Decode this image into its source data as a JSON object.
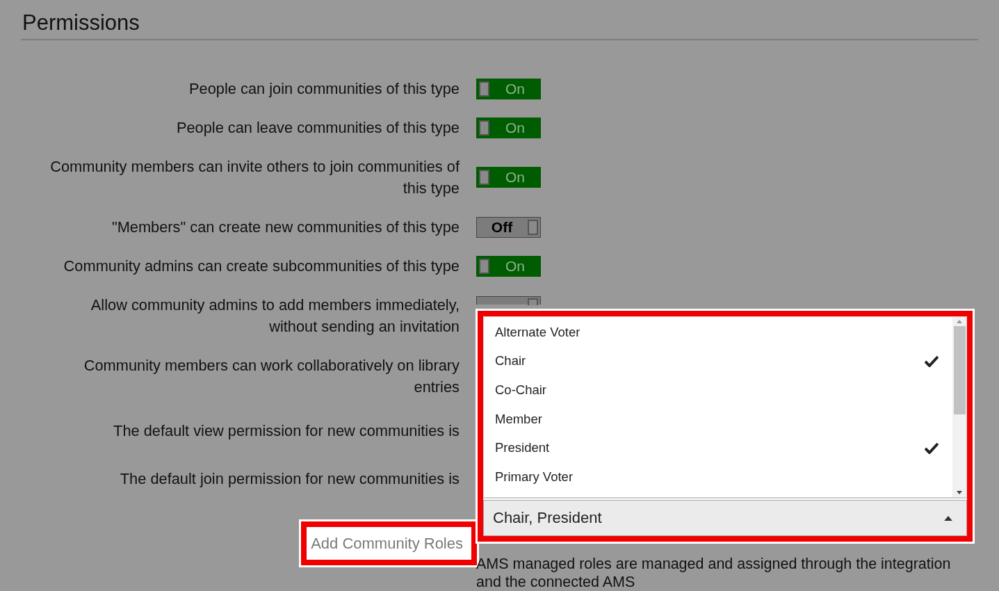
{
  "heading": "Permissions",
  "settings": [
    {
      "label": "People can join communities of this type",
      "kind": "toggle",
      "on": true,
      "toggle_text": "On"
    },
    {
      "label": "People can leave communities of this type",
      "kind": "toggle",
      "on": true,
      "toggle_text": "On"
    },
    {
      "label": "Community members can invite others to join communities of this type",
      "kind": "toggle",
      "on": true,
      "toggle_text": "On"
    },
    {
      "label": "\"Members\" can create new communities of this type",
      "kind": "toggle",
      "on": false,
      "toggle_text": "Off"
    },
    {
      "label": "Community admins can create subcommunities of this type",
      "kind": "toggle",
      "on": true,
      "toggle_text": "On"
    },
    {
      "label": "Allow community admins to add members immediately, without sending an invitation",
      "kind": "toggle-covered",
      "on": false
    },
    {
      "label": "Community members can work collaboratively on library entries",
      "kind": "covered"
    },
    {
      "label": "The default view permission for new communities is",
      "kind": "covered"
    },
    {
      "label": "The default join permission for new communities is",
      "kind": "covered"
    }
  ],
  "roles": {
    "label": "Add Community Roles",
    "highlighted": true,
    "note": "AMS managed roles are managed and assigned through the integration and the connected AMS"
  },
  "dropdown": {
    "highlighted": true,
    "expanded": true,
    "value": "Chair, President",
    "options": [
      {
        "label": "Alternate Voter",
        "checked": false
      },
      {
        "label": "Chair",
        "checked": true
      },
      {
        "label": "Co-Chair",
        "checked": false
      },
      {
        "label": "Member",
        "checked": false
      },
      {
        "label": "President",
        "checked": true
      },
      {
        "label": "Primary Voter",
        "checked": false
      }
    ]
  }
}
